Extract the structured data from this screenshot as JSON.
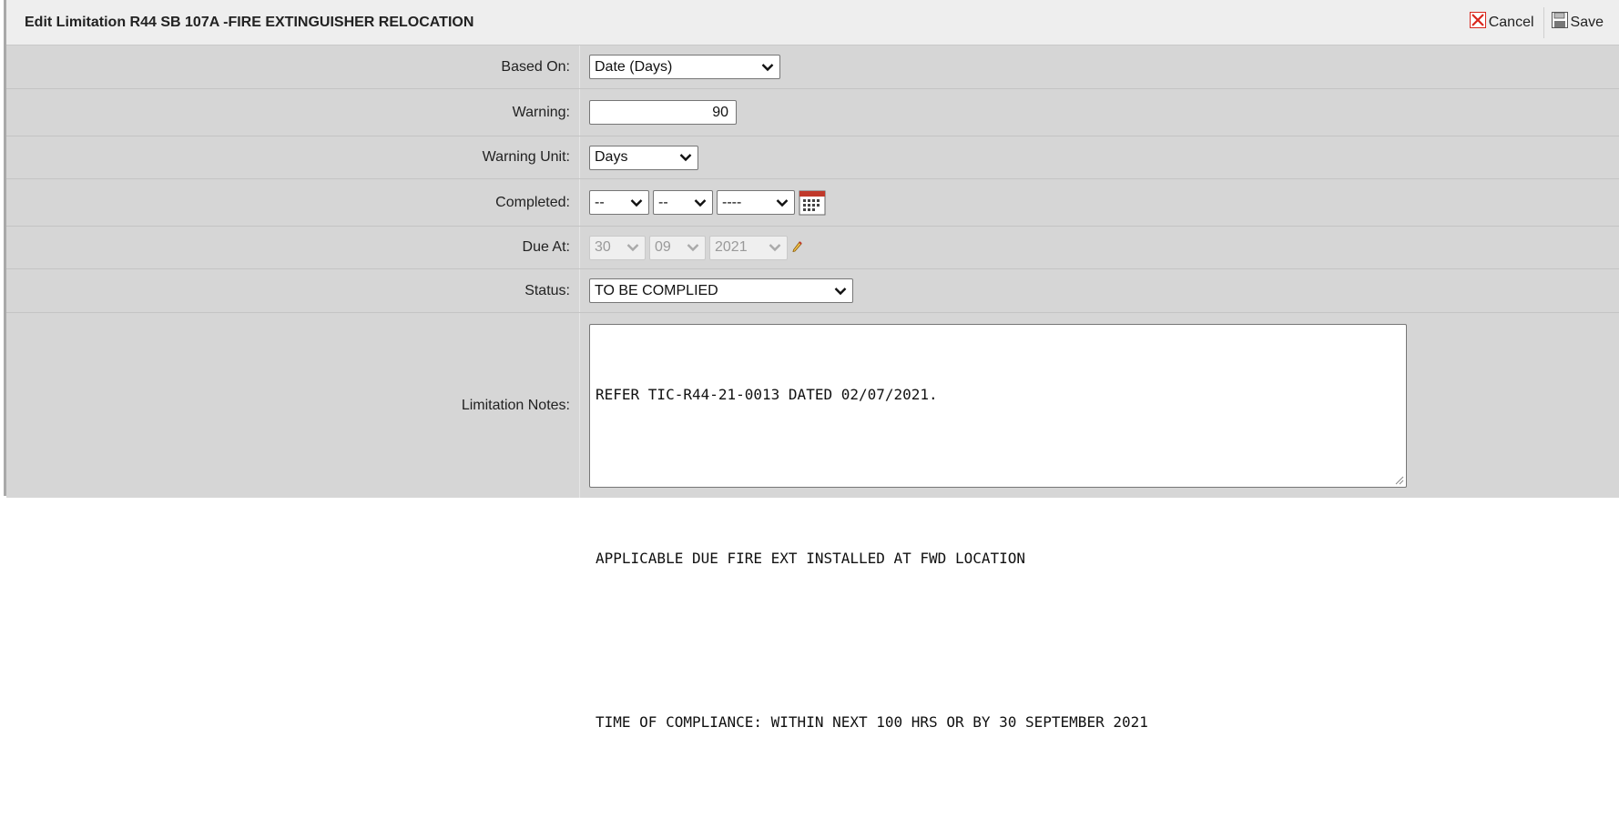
{
  "header": {
    "title": "Edit Limitation R44 SB 107A -FIRE EXTINGUISHER RELOCATION",
    "cancel_label": "Cancel",
    "save_label": "Save"
  },
  "form": {
    "based_on": {
      "label": "Based On:",
      "value": "Date (Days)"
    },
    "warning": {
      "label": "Warning:",
      "value": "90"
    },
    "warning_unit": {
      "label": "Warning Unit:",
      "value": "Days"
    },
    "completed": {
      "label": "Completed:",
      "day": "--",
      "month": "--",
      "year": "----"
    },
    "due_at": {
      "label": "Due At:",
      "day": "30",
      "month": "09",
      "year": "2021"
    },
    "status": {
      "label": "Status:",
      "value": "TO BE COMPLIED"
    },
    "notes": {
      "label": "Limitation Notes:",
      "lines": [
        "REFER TIC-R44-21-0013 DATED 02/07/2021.",
        "",
        "APPLICABLE DUE FIRE EXT INSTALLED AT FWD LOCATION",
        "",
        "TIME OF COMPLIANCE: WITHIN NEXT 100 HRS OR BY 30 SEPTEMBER 2021"
      ]
    }
  },
  "colors": {
    "header_bg": "#eeeeee",
    "panel_bg": "#d6d6d6",
    "cancel_icon": "#d9261c",
    "calendar_icon": "#c0392b"
  },
  "icons": [
    "cancel-icon",
    "save-icon",
    "chevron-down-icon",
    "calendar-icon",
    "pencil-icon",
    "resize-grip-icon"
  ]
}
